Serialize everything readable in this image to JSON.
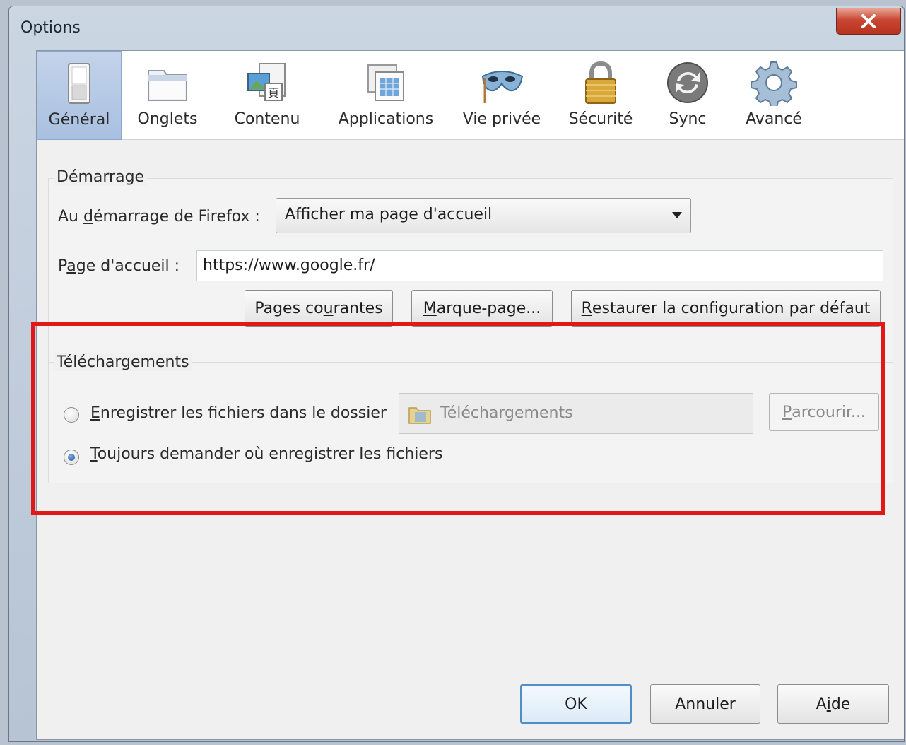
{
  "window": {
    "title": "Options"
  },
  "tabs": [
    {
      "label": "Général",
      "icon": "general-switch-icon",
      "active": true
    },
    {
      "label": "Onglets",
      "icon": "tabs-icon",
      "active": false
    },
    {
      "label": "Contenu",
      "icon": "content-icon",
      "active": false
    },
    {
      "label": "Applications",
      "icon": "applications-icon",
      "active": false
    },
    {
      "label": "Vie privée",
      "icon": "privacy-mask-icon",
      "active": false
    },
    {
      "label": "Sécurité",
      "icon": "security-padlock-icon",
      "active": false
    },
    {
      "label": "Sync",
      "icon": "sync-icon",
      "active": false
    },
    {
      "label": "Avancé",
      "icon": "advanced-gear-icon",
      "active": false
    }
  ],
  "startup": {
    "group_title": "Démarrage",
    "on_start_label_pre": "Au ",
    "on_start_label_access": "d",
    "on_start_label_post": "émarrage de Firefox :",
    "on_start_value": "Afficher ma page d'accueil",
    "homepage_label_pre": "P",
    "homepage_label_access": "a",
    "homepage_label_post": "ge d'accueil :",
    "homepage_value": "https://www.google.fr/",
    "btn_current_pre": "Pages co",
    "btn_current_access": "u",
    "btn_current_post": "rantes",
    "btn_bookmark_access": "M",
    "btn_bookmark_post": "arque-page...",
    "btn_restore_access": "R",
    "btn_restore_post": "estaurer la configuration par défaut"
  },
  "downloads": {
    "group_title": "Téléchargements",
    "save_to_access": "E",
    "save_to_post": "nregistrer les fichiers dans le dossier",
    "folder_value": "Téléchargements",
    "browse_access": "P",
    "browse_post": "arcourir...",
    "always_ask_access": "T",
    "always_ask_post": "oujours demander où enregistrer les fichiers",
    "selected": "always_ask"
  },
  "footer": {
    "ok": "OK",
    "cancel": "Annuler",
    "help_pre": "A",
    "help_access": "i",
    "help_post": "de"
  },
  "colors": {
    "highlight": "#e01818",
    "active_tab": "#b6c9e6",
    "close_button": "#c84732"
  }
}
